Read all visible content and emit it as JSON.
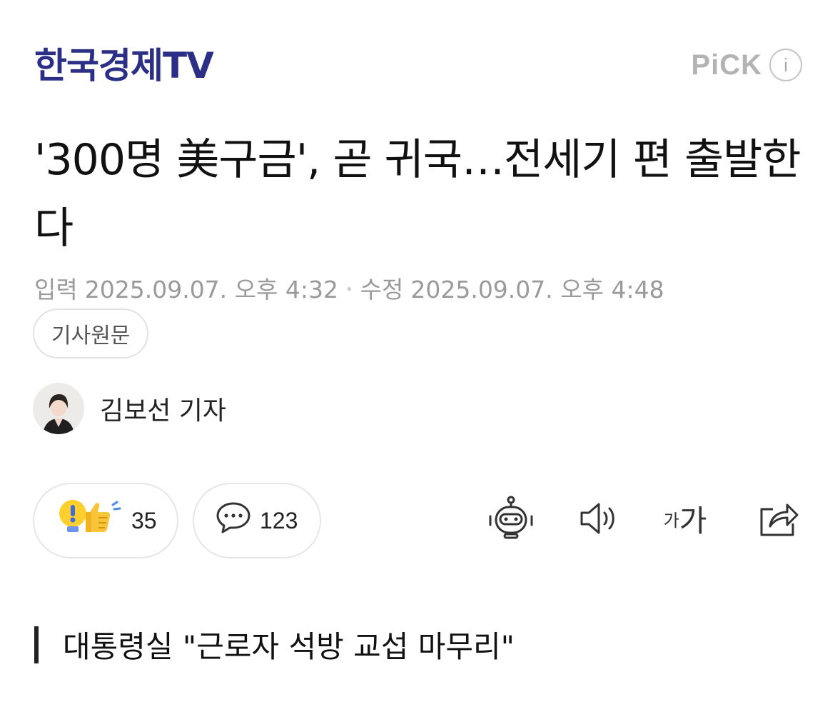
{
  "header": {
    "press_name": "한국경제TV",
    "pick_label": "PiCK",
    "info_icon_text": "i"
  },
  "article": {
    "headline": "'300명 美구금', 곧 귀국…전세기 편 출발한다",
    "input_label": "입력",
    "input_datetime": "2025.09.07. 오후 4:32",
    "modified_label": "수정",
    "modified_datetime": "2025.09.07. 오후 4:48",
    "original_button": "기사원문",
    "reporter": "김보선 기자",
    "subheading": "대통령실 \"근로자 석방 교섭 마무리\""
  },
  "actions": {
    "reaction_count": "35",
    "comment_count": "123",
    "font_size_small": "가",
    "font_size_large": "가"
  },
  "colors": {
    "press_logo": "#2b2f86",
    "meta_text": "#9a9a9a"
  },
  "icons": [
    "info-icon",
    "reaction-icon",
    "comment-icon",
    "summary-bot-icon",
    "speaker-icon",
    "font-size-icon",
    "share-icon"
  ]
}
